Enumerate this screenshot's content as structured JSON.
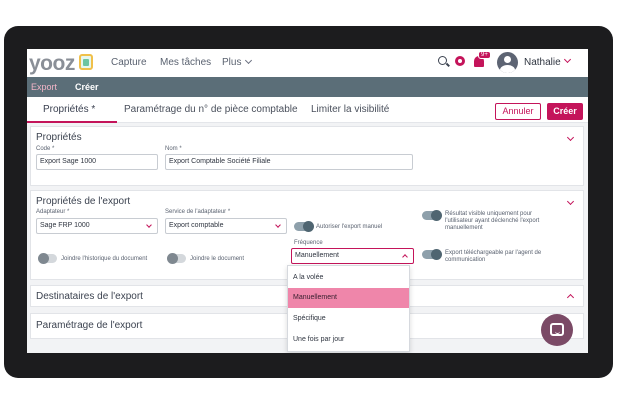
{
  "app": {
    "logo": "yooz"
  },
  "nav": {
    "capture": "Capture",
    "tasks": "Mes tâches",
    "more": "Plus"
  },
  "notifications": {
    "badge": "9+"
  },
  "user": {
    "name": "Nathalie"
  },
  "breadcrumb": {
    "home": "Export",
    "current": "Créer"
  },
  "tabs": [
    {
      "label": "Propriétés *"
    },
    {
      "label": "Paramétrage du n° de pièce comptable"
    },
    {
      "label": "Limiter la visibilité"
    }
  ],
  "actions": {
    "cancel": "Annuler",
    "create": "Créer"
  },
  "properties": {
    "title": "Propriétés",
    "code_label": "Code *",
    "code_value": "Export Sage 1000",
    "name_label": "Nom *",
    "name_value": "Export Comptable Société Filiale"
  },
  "export_props": {
    "title": "Propriétés de l'export",
    "adapter_label": "Adaptateur *",
    "adapter_value": "Sage FRP 1000",
    "service_label": "Service de l'adaptateur *",
    "service_value": "Export comptable",
    "manual_export_label": "Autoriser l'export manuel",
    "result_visible_label": "Résultat visible uniquement pour l'utilisateur ayant déclenché l'export manuellement",
    "frequency_label": "Fréquence",
    "frequency_value": "Manuellement",
    "downloadable_label": "Export téléchargeable par l'agent de communication",
    "history_label": "Joindre l'historique du document",
    "attach_doc_label": "Joindre le document",
    "frequency_options": [
      "A la volée",
      "Manuellement",
      "Spécifique",
      "Une fois par jour"
    ]
  },
  "recipients": {
    "title": "Destinataires de l'export"
  },
  "settings": {
    "title": "Paramétrage de l'export"
  },
  "toggles": {
    "manual_export": true,
    "result_visible": true,
    "downloadable": true,
    "history": false,
    "attach_doc": false
  },
  "colors": {
    "accent": "#c4145a",
    "breadcrumb_bg": "#5b6e78",
    "selected_option": "#ef86aa",
    "chat_button": "#7b4a66"
  }
}
